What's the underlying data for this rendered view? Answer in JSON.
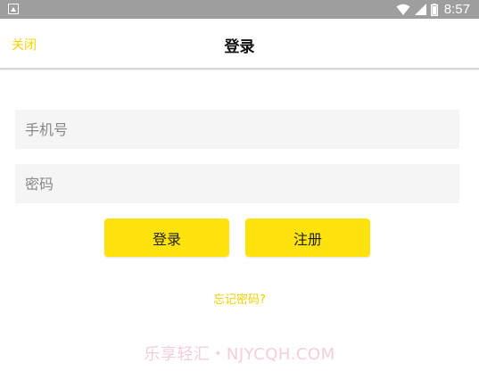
{
  "status_bar": {
    "time": "8:57"
  },
  "nav": {
    "close_label": "关闭",
    "title": "登录"
  },
  "form": {
    "phone_placeholder": "手机号",
    "password_placeholder": "密码",
    "login_label": "登录",
    "register_label": "注册",
    "forgot_label": "忘记密码?"
  },
  "watermark": "乐享轻汇・NJYCQH.COM",
  "colors": {
    "accent": "#ffe30b",
    "link": "#f2cf00",
    "status_bar": "#9e9e9e"
  }
}
